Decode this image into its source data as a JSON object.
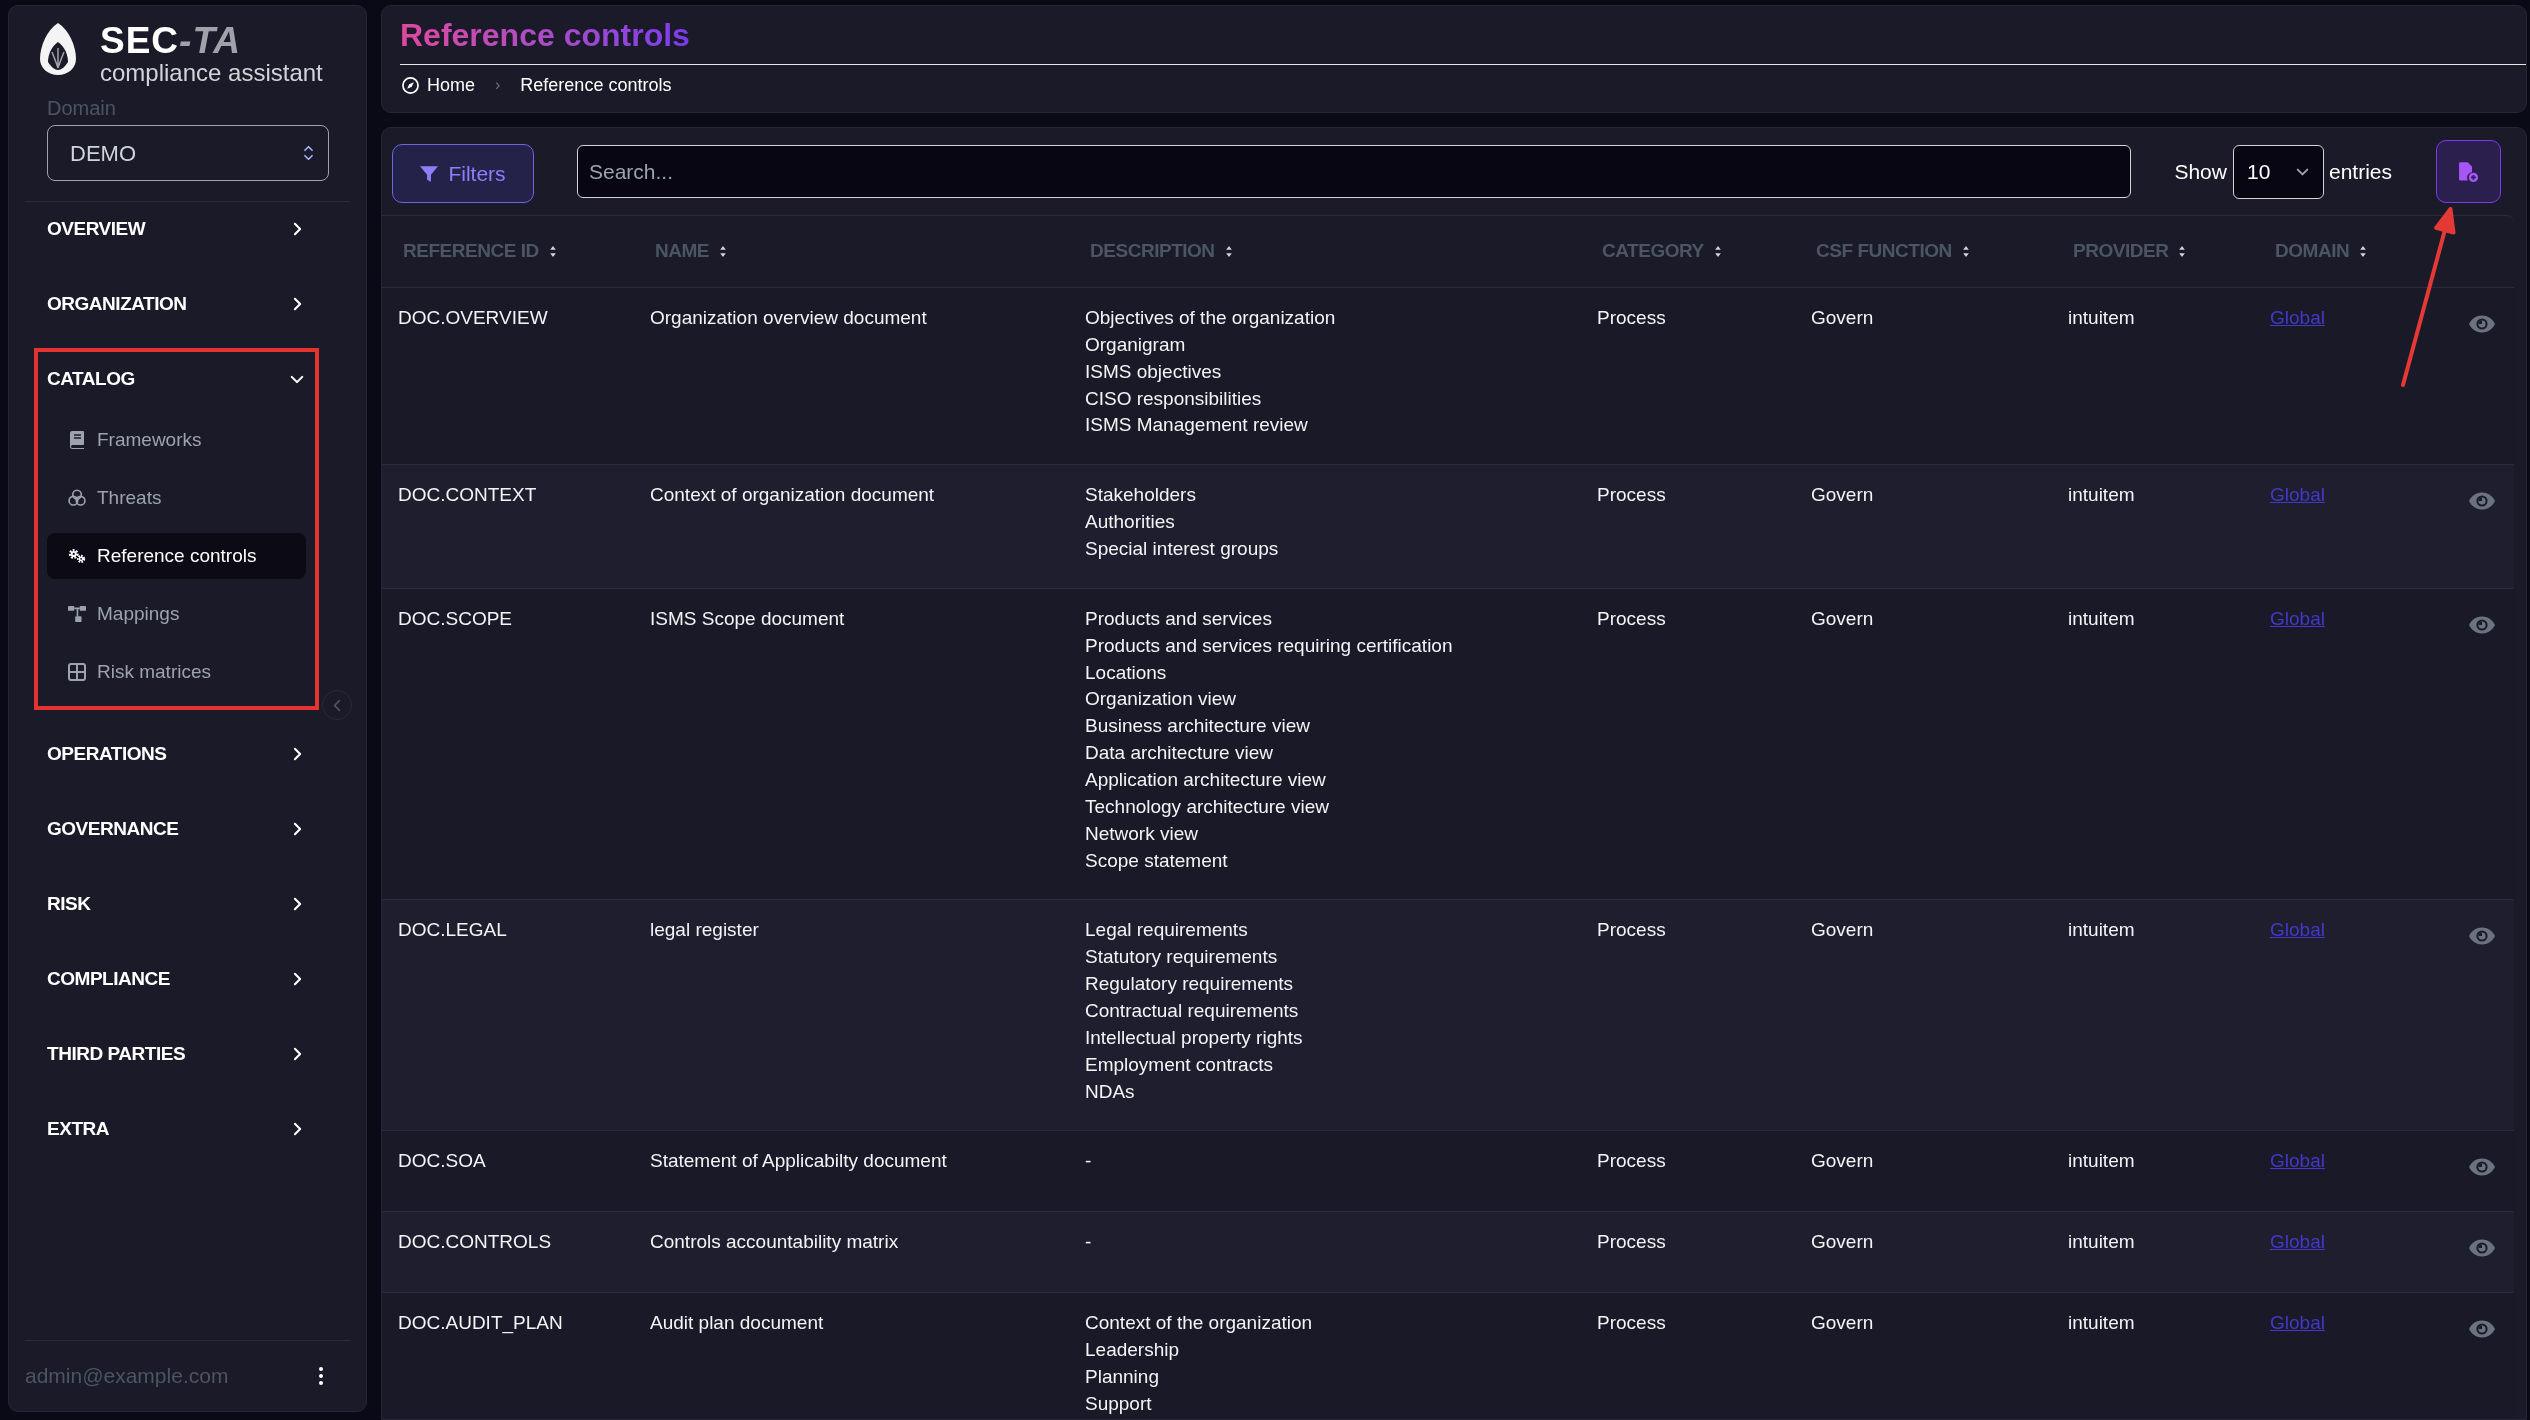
{
  "sidebar": {
    "brand": {
      "title": "SEC",
      "title_suffix": "-TA",
      "subtitle": "compliance assistant"
    },
    "domain": {
      "label": "Domain",
      "value": "DEMO"
    },
    "nav": [
      {
        "label": "OVERVIEW",
        "expanded": false,
        "highlighted": false
      },
      {
        "label": "ORGANIZATION",
        "expanded": false,
        "highlighted": false
      },
      {
        "label": "CATALOG",
        "expanded": true,
        "highlighted": true,
        "children": [
          {
            "label": "Frameworks",
            "selected": false
          },
          {
            "label": "Threats",
            "selected": false
          },
          {
            "label": "Reference controls",
            "selected": true
          },
          {
            "label": "Mappings",
            "selected": false
          },
          {
            "label": "Risk matrices",
            "selected": false
          }
        ]
      },
      {
        "label": "OPERATIONS",
        "expanded": false,
        "highlighted": false
      },
      {
        "label": "GOVERNANCE",
        "expanded": false,
        "highlighted": false
      },
      {
        "label": "RISK",
        "expanded": false,
        "highlighted": false
      },
      {
        "label": "COMPLIANCE",
        "expanded": false,
        "highlighted": false
      },
      {
        "label": "THIRD PARTIES",
        "expanded": false,
        "highlighted": false
      },
      {
        "label": "EXTRA",
        "expanded": false,
        "highlighted": false
      }
    ],
    "user": {
      "email": "admin@example.com"
    }
  },
  "header": {
    "title": "Reference controls",
    "separator": "›",
    "breadcrumbs": [
      {
        "label": "Home"
      },
      {
        "label": "Reference controls"
      }
    ]
  },
  "toolbar": {
    "filters": {
      "label": "Filters"
    },
    "search": {
      "placeholder": "Search..."
    },
    "page_size": {
      "prefix": "Show",
      "value": "10",
      "suffix": "entries"
    },
    "add_button": {
      "highlighted": true
    }
  },
  "table": {
    "columns": [
      {
        "label": "REFERENCE ID"
      },
      {
        "label": "NAME"
      },
      {
        "label": "DESCRIPTION"
      },
      {
        "label": "CATEGORY"
      },
      {
        "label": "CSF FUNCTION"
      },
      {
        "label": "PROVIDER"
      },
      {
        "label": "DOMAIN"
      }
    ],
    "rows": [
      {
        "ref_id": "DOC.OVERVIEW",
        "name": "Organization overview document",
        "description": [
          "Objectives of the organization",
          "Organigram",
          "ISMS objectives",
          "CISO responsibilities",
          "ISMS Management review"
        ],
        "category": "Process",
        "csf_function": "Govern",
        "provider": "intuitem",
        "domain": "Global"
      },
      {
        "ref_id": "DOC.CONTEXT",
        "name": "Context of organization document",
        "description": [
          "Stakeholders",
          "Authorities",
          "Special interest groups"
        ],
        "category": "Process",
        "csf_function": "Govern",
        "provider": "intuitem",
        "domain": "Global"
      },
      {
        "ref_id": "DOC.SCOPE",
        "name": "ISMS Scope document",
        "description": [
          "Products and services",
          "Products and services requiring certification",
          "Locations",
          "Organization view",
          "Business architecture view",
          "Data architecture view",
          "Application architecture view",
          "Technology architecture view",
          "Network view",
          "Scope statement"
        ],
        "category": "Process",
        "csf_function": "Govern",
        "provider": "intuitem",
        "domain": "Global"
      },
      {
        "ref_id": "DOC.LEGAL",
        "name": "legal register",
        "description": [
          "Legal requirements",
          "Statutory requirements",
          "Regulatory requirements",
          "Contractual requirements",
          "Intellectual property rights",
          "Employment contracts",
          "NDAs"
        ],
        "category": "Process",
        "csf_function": "Govern",
        "provider": "intuitem",
        "domain": "Global"
      },
      {
        "ref_id": "DOC.SOA",
        "name": "Statement of Applicabilty document",
        "description": [
          "-"
        ],
        "category": "Process",
        "csf_function": "Govern",
        "provider": "intuitem",
        "domain": "Global"
      },
      {
        "ref_id": "DOC.CONTROLS",
        "name": "Controls accountability matrix",
        "description": [
          "-"
        ],
        "category": "Process",
        "csf_function": "Govern",
        "provider": "intuitem",
        "domain": "Global"
      },
      {
        "ref_id": "DOC.AUDIT_PLAN",
        "name": "Audit plan document",
        "description": [
          "Context of the organization",
          "Leadership",
          "Planning",
          "Support"
        ],
        "category": "Process",
        "csf_function": "Govern",
        "provider": "intuitem",
        "domain": "Global"
      }
    ]
  }
}
